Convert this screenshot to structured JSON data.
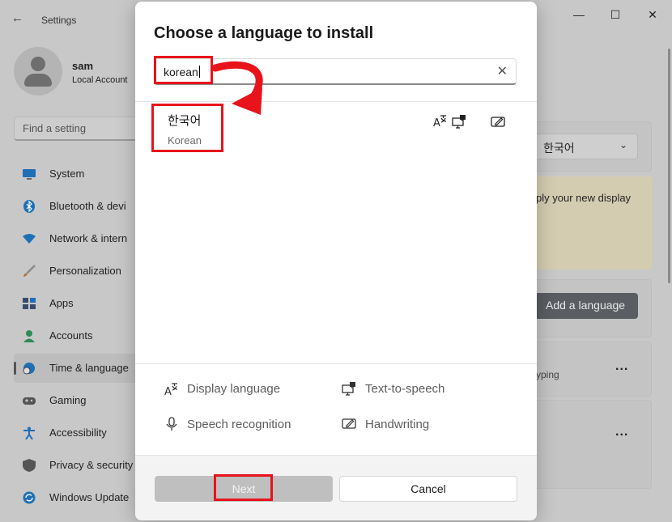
{
  "window": {
    "app_title": "Settings",
    "back_glyph": "←",
    "minimize_glyph": "—",
    "maximize_glyph": "☐",
    "close_glyph": "✕"
  },
  "user": {
    "name": "sam",
    "account_type": "Local Account"
  },
  "sidebar": {
    "search_placeholder": "Find a setting",
    "items": [
      {
        "label": "System",
        "icon": "monitor-icon",
        "color": "#1f6fb5"
      },
      {
        "label": "Bluetooth & devi",
        "icon": "bluetooth-icon",
        "color": "#1f6fb5"
      },
      {
        "label": "Network & intern",
        "icon": "wifi-icon",
        "color": "#1f6fb5"
      },
      {
        "label": "Personalization",
        "icon": "brush-icon",
        "color": "#b5651d"
      },
      {
        "label": "Apps",
        "icon": "apps-icon",
        "color": "#3a4a6b"
      },
      {
        "label": "Accounts",
        "icon": "person-icon",
        "color": "#2e8b57"
      },
      {
        "label": "Time & language",
        "icon": "clock-globe-icon",
        "color": "#1f6fb5"
      },
      {
        "label": "Gaming",
        "icon": "gamepad-icon",
        "color": "#555555"
      },
      {
        "label": "Accessibility",
        "icon": "accessibility-icon",
        "color": "#1f6fb5"
      },
      {
        "label": "Privacy & security",
        "icon": "shield-icon",
        "color": "#555555"
      },
      {
        "label": "Windows Update",
        "icon": "update-icon",
        "color": "#1f6fb5"
      }
    ],
    "active_index": 6
  },
  "background_content": {
    "display_language_value": "한국어",
    "notice_text": "ply your new display",
    "add_language_label": "Add a language",
    "typing_text": "yping",
    "ellipsis": "..."
  },
  "dialog": {
    "title": "Choose a language to install",
    "search_value": "korean",
    "clear_glyph": "✕",
    "result": {
      "native_name": "한국어",
      "english_name": "Korean",
      "features": [
        "display-language-icon",
        "text-to-speech-icon",
        "handwriting-icon"
      ]
    },
    "legend": {
      "display_language": "Display language",
      "text_to_speech": "Text-to-speech",
      "speech_recognition": "Speech recognition",
      "handwriting": "Handwriting"
    },
    "next_label": "Next",
    "cancel_label": "Cancel"
  },
  "colors": {
    "annotation_red": "#e8131b",
    "disabled_button": "#bfbfbf",
    "accent_dark": "#5a5d62"
  }
}
